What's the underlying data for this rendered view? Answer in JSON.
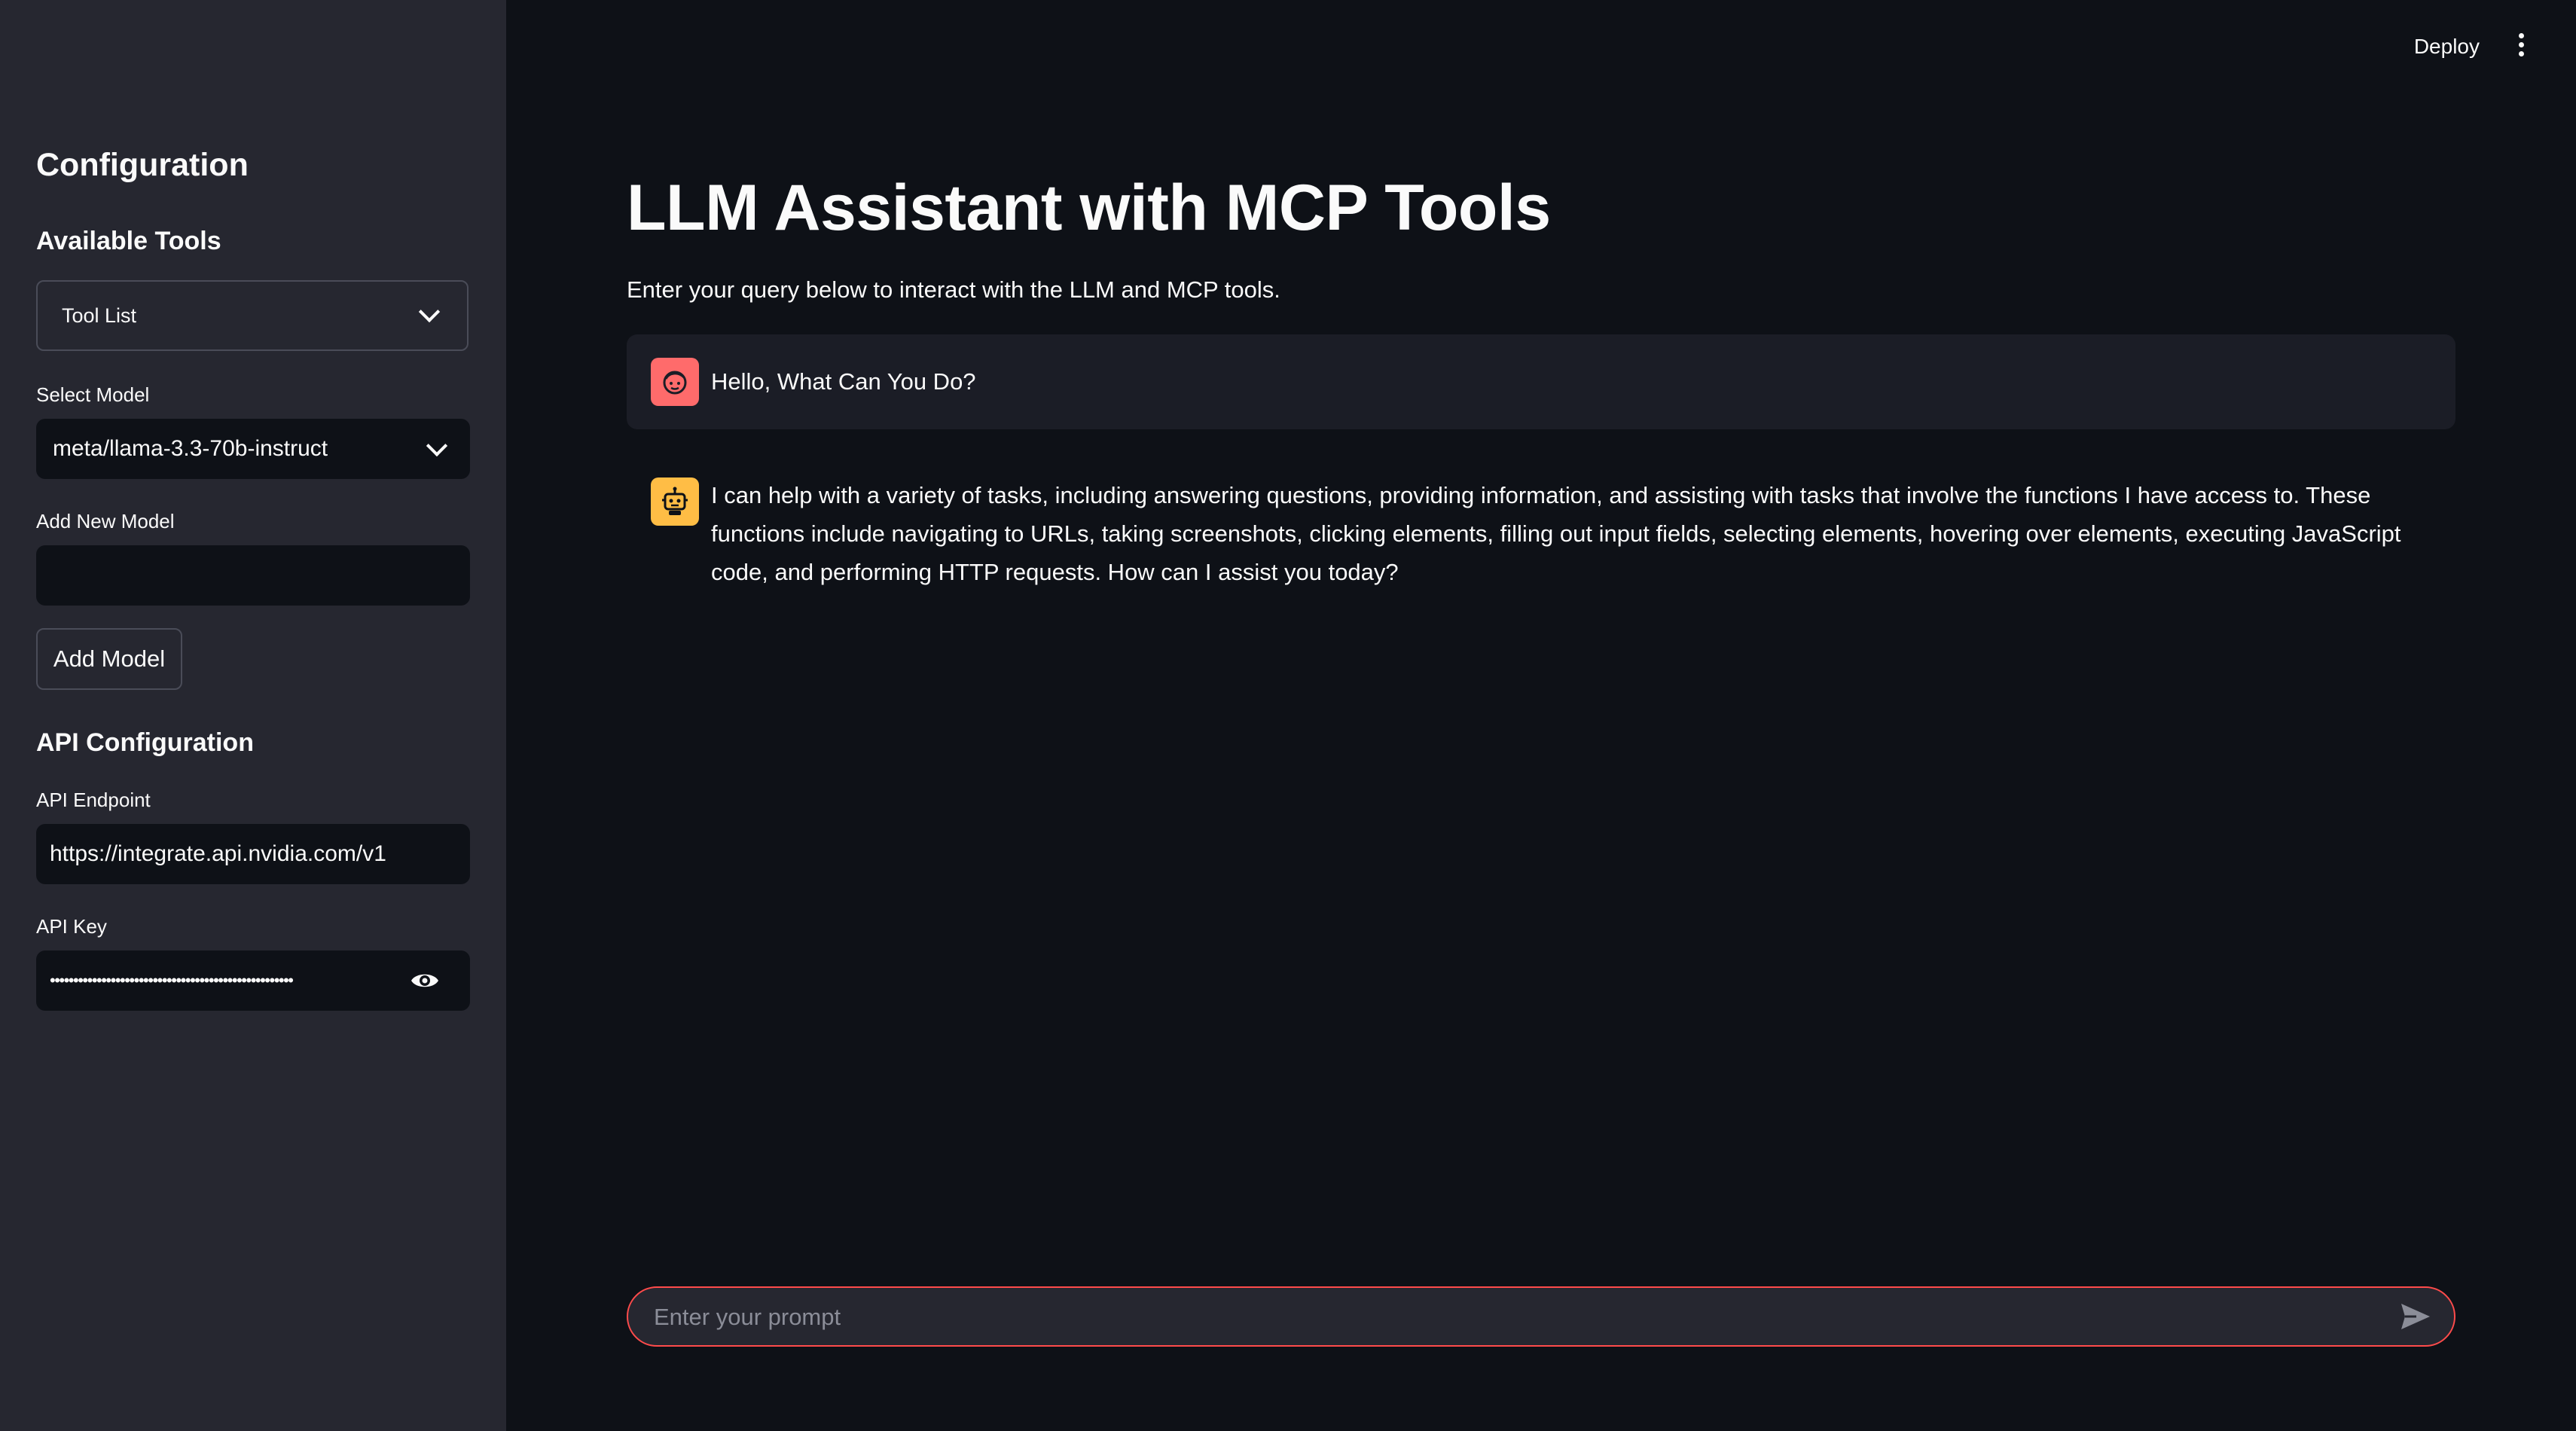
{
  "header": {
    "deploy_label": "Deploy",
    "menu_icon": "kebab-menu-icon"
  },
  "sidebar": {
    "title": "Configuration",
    "available_tools_heading": "Available Tools",
    "tool_list_label": "Tool List",
    "select_model_label": "Select Model",
    "selected_model": "meta/llama-3.3-70b-instruct",
    "add_new_model_label": "Add New Model",
    "add_new_model_value": "",
    "add_model_button": "Add Model",
    "api_heading": "API Configuration",
    "api_endpoint_label": "API Endpoint",
    "api_endpoint_value": "https://integrate.api.nvidia.com/v1",
    "api_key_label": "API Key",
    "api_key_masked": "••••••••••••••••••••••••••••••••••••••••••••••••••••"
  },
  "main": {
    "title": "LLM Assistant with MCP Tools",
    "subtitle": "Enter your query below to interact with the LLM and MCP tools.",
    "messages": [
      {
        "role": "user",
        "avatar_icon": "user-face-icon",
        "text": "Hello, What Can You Do?"
      },
      {
        "role": "assistant",
        "avatar_icon": "robot-icon",
        "text": "I can help with a variety of tasks, including answering questions, providing information, and assisting with tasks that involve the functions I have access to. These functions include navigating to URLs, taking screenshots, clicking elements, filling out input fields, selecting elements, hovering over elements, executing JavaScript code, and performing HTTP requests. How can I assist you today?"
      }
    ],
    "chat_input_placeholder": "Enter your prompt"
  },
  "colors": {
    "sidebar_bg": "#262730",
    "main_bg": "#0e1117",
    "accent": "#ff4b4b",
    "user_avatar": "#ff6b6b",
    "bot_avatar": "#ffbd45"
  }
}
